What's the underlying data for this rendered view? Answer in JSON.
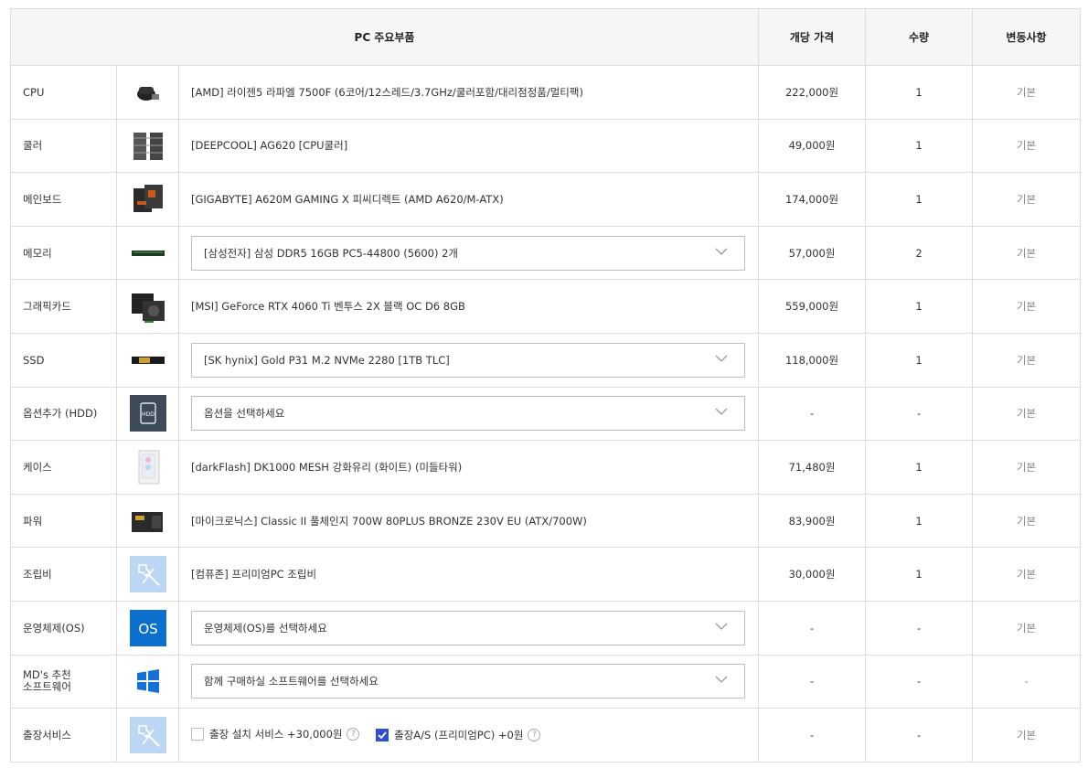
{
  "header": {
    "parts": "PC 주요부품",
    "price": "개당 가격",
    "qty": "수량",
    "change": "변동사항"
  },
  "rows": [
    {
      "category": "CPU",
      "icon": "cpu-icon",
      "desc": "[AMD] 라이젠5 라파엘 7500F (6코어/12스레드/3.7GHz/쿨러포함/대리점정품/멀티팩)",
      "price": "222,000원",
      "qty": "1",
      "change": "기본"
    },
    {
      "category": "쿨러",
      "icon": "cooler-icon",
      "desc": "[DEEPCOOL] AG620 [CPU쿨러]",
      "price": "49,000원",
      "qty": "1",
      "change": "기본"
    },
    {
      "category": "메인보드",
      "icon": "motherboard-icon",
      "desc": "[GIGABYTE] A620M GAMING X 피씨디렉트 (AMD A620/M-ATX)",
      "price": "174,000원",
      "qty": "1",
      "change": "기본"
    },
    {
      "category": "메모리",
      "icon": "memory-icon",
      "desc": "[삼성전자] 삼성 DDR5 16GB PC5-44800 (5600) 2개",
      "price": "57,000원",
      "qty": "2",
      "change": "기본"
    },
    {
      "category": "그래픽카드",
      "icon": "gpu-icon",
      "desc": "[MSI] GeForce RTX 4060 Ti 벤투스 2X 블랙 OC D6 8GB",
      "price": "559,000원",
      "qty": "1",
      "change": "기본"
    },
    {
      "category": "SSD",
      "icon": "ssd-icon",
      "desc": "[SK hynix] Gold P31 M.2 NVMe 2280 [1TB TLC]",
      "price": "118,000원",
      "qty": "1",
      "change": "기본"
    },
    {
      "category": "옵션추가 (HDD)",
      "icon": "hdd-icon",
      "desc": "옵션을 선택하세요",
      "price": "-",
      "qty": "-",
      "change": "기본"
    },
    {
      "category": "케이스",
      "icon": "case-icon",
      "desc": "[darkFlash] DK1000 MESH 강화유리 (화이트) (미들타워)",
      "price": "71,480원",
      "qty": "1",
      "change": "기본"
    },
    {
      "category": "파워",
      "icon": "psu-icon",
      "desc": "[마이크로닉스] Classic II 풀체인지 700W 80PLUS BRONZE 230V EU (ATX/700W)",
      "price": "83,900원",
      "qty": "1",
      "change": "기본"
    },
    {
      "category": "조립비",
      "icon": "assembly-tools-icon",
      "desc": "[컴퓨존] 프리미엄PC 조립비",
      "price": "30,000원",
      "qty": "1",
      "change": "기본"
    },
    {
      "category": "운영체제(OS)",
      "icon": "os-icon",
      "desc": "운영체제(OS)를 선택하세요",
      "price": "-",
      "qty": "-",
      "change": "기본"
    },
    {
      "category": "MD's 추천\n소프트웨어",
      "icon": "windows-icon",
      "desc": "함께 구매하실 소프트웨어를 선택하세요",
      "price": "-",
      "qty": "-",
      "change": "-"
    },
    {
      "category": "출장서비스",
      "icon": "service-tools-icon",
      "price": "-",
      "qty": "-",
      "change": "기본"
    }
  ],
  "service_options": [
    {
      "label": "출장 설치 서비스 +30,000원",
      "checked": false
    },
    {
      "label": "출장A/S (프리미엄PC) +0원",
      "checked": true
    }
  ],
  "os_icon_text": "OS",
  "hdd_icon_text": "HDD",
  "colors": {
    "accent": "#2c4fd6",
    "os_blue": "#0b6fce",
    "tool_bg": "#bcd7f3"
  }
}
